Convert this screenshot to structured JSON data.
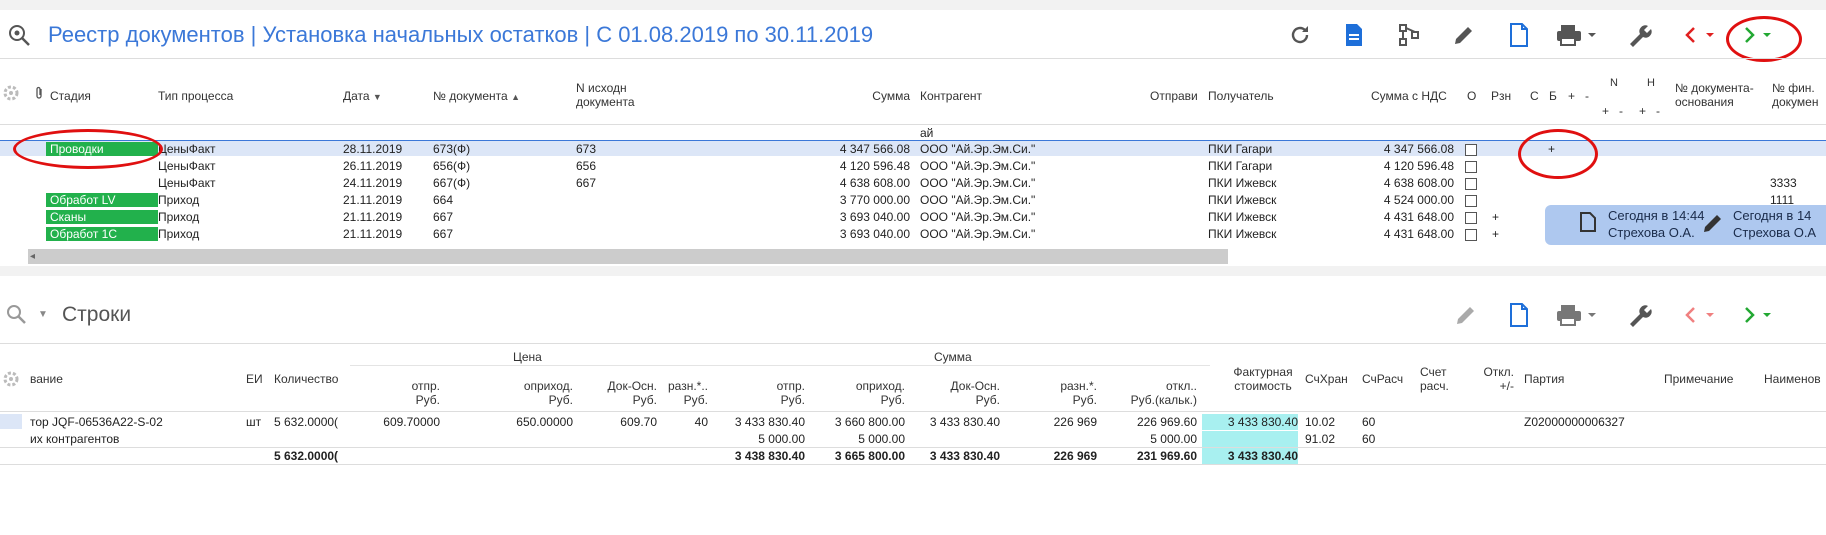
{
  "header": {
    "title": "Реестр документов | Установка начальных остатков | С 01.08.2019 по 30.11.2019"
  },
  "colors": {
    "accent": "#3b78d8",
    "badge": "#22b14c",
    "teal": "#a8f0f0",
    "highlight": "#e01010",
    "selected_row": "#dce6f7"
  },
  "icons": [
    "search-settings-icon",
    "refresh-icon",
    "document-icon",
    "process-icon",
    "edit-icon",
    "new-document-icon",
    "print-icon",
    "tools-icon",
    "prev-icon",
    "next-icon",
    "gear-icon",
    "attachment-icon"
  ],
  "top_table": {
    "headers": {
      "stage": "Стадия",
      "process_type": "Тип процесса",
      "date": "Дата",
      "doc_num": "№ документа",
      "orig_doc_1": "N исходн",
      "orig_doc_2": "документа",
      "sum": "Сумма",
      "contractor": "Контрагент",
      "sender": "Отправи",
      "receiver": "Получатель",
      "sum_vat": "Сумма с НДС",
      "o": "О",
      "rzn": "Рзн",
      "c": "С",
      "b": "Б",
      "plus": "+",
      "minus": "-",
      "n": "N",
      "h": "Н",
      "nplus": "+",
      "nminus": "-",
      "hplus": "+",
      "hminus": "-",
      "base_doc_1": "№ документа-",
      "base_doc_2": "основания",
      "fin_doc_1": "№ фин.",
      "fin_doc_2": "докумен"
    },
    "filter_text": "ай",
    "rows": [
      {
        "stage": "Проводки",
        "type": "ЦеныФакт",
        "date": "28.11.2019",
        "num": "673(Ф)",
        "orig": "673",
        "sum": "4 347 566.08",
        "contr": "ООО \"Ай.Эр.Эм.Си.\"",
        "recv": "ПКИ Гагари",
        "sumvat": "4 347 566.08",
        "plus": "",
        "fin": "+",
        "extra": ""
      },
      {
        "stage": "",
        "type": "ЦеныФакт",
        "date": "26.11.2019",
        "num": "656(Ф)",
        "orig": "656",
        "sum": "4 120 596.48",
        "contr": "ООО \"Ай.Эр.Эм.Си.\"",
        "recv": "ПКИ Гагари",
        "sumvat": "4 120 596.48",
        "plus": "",
        "fin": "",
        "extra": ""
      },
      {
        "stage": "",
        "type": "ЦеныФакт",
        "date": "24.11.2019",
        "num": "667(Ф)",
        "orig": "667",
        "sum": "4 638 608.00",
        "contr": "ООО \"Ай.Эр.Эм.Си.\"",
        "recv": "ПКИ Ижевск",
        "sumvat": "4 638 608.00",
        "plus": "",
        "fin": "",
        "extra": "3333"
      },
      {
        "stage": "Обработ LV",
        "type": "Приход",
        "date": "21.11.2019",
        "num": "664",
        "orig": "",
        "sum": "3 770 000.00",
        "contr": "ООО \"Ай.Эр.Эм.Си.\"",
        "recv": "ПКИ Ижевск",
        "sumvat": "4 524 000.00",
        "plus": "",
        "fin": "",
        "extra": "1111"
      },
      {
        "stage": "Сканы",
        "type": "Приход",
        "date": "21.11.2019",
        "num": "667",
        "orig": "",
        "sum": "3 693 040.00",
        "contr": "ООО \"Ай.Эр.Эм.Си.\"",
        "recv": "ПКИ Ижевск",
        "sumvat": "4 431 648.00",
        "plus": "+",
        "fin": "",
        "extra": ""
      },
      {
        "stage": "Обработ 1С",
        "type": "Приход",
        "date": "21.11.2019",
        "num": "667",
        "orig": "",
        "sum": "3 693 040.00",
        "contr": "ООО \"Ай.Эр.Эм.Си.\"",
        "recv": "ПКИ Ижевск",
        "sumvat": "4 431 648.00",
        "plus": "+",
        "fin": "",
        "extra": ""
      }
    ]
  },
  "notification": {
    "item1_line1": "Сегодня в 14:44",
    "item1_line2": "Стрехова О.А.",
    "item2_line1": "Сегодня в 14",
    "item2_line2": "Стрехова О.А"
  },
  "lines_panel": {
    "title": "Строки",
    "headers": {
      "name": "вание",
      "unit": "ЕИ",
      "qty": "Количество",
      "price_group": "Цена",
      "sum_group": "Сумма",
      "p_otpr_1": "отпр.",
      "p_otpr_2": "Руб.",
      "p_oprih_1": "оприход.",
      "p_oprih_2": "Руб.",
      "p_dok_1": "Док-Осн.",
      "p_dok_2": "Руб.",
      "p_razn_1": "разн.*..",
      "p_razn_2": "Руб.",
      "s_otpr_1": "отпр.",
      "s_otpr_2": "Руб.",
      "s_oprih_1": "оприход.",
      "s_oprih_2": "Руб.",
      "s_dok_1": "Док-Осн.",
      "s_dok_2": "Руб.",
      "s_razn_1": "разн.*.",
      "s_razn_2": "Руб.",
      "s_otkl_1": "откл..",
      "s_otkl_2": "Руб.(кальк.)",
      "fact_1": "Фактурная",
      "fact_2": "стоимость",
      "sch_hran": "СчХран",
      "sch_rasch": "СчРасч",
      "schet_1": "Счет",
      "schet_2": "расч.",
      "otkl_1": "Откл.",
      "otkl_2": "+/-",
      "partiya": "Партия",
      "prim": "Примечание",
      "naim": "Наименов"
    },
    "rows": [
      {
        "name": "тор JQF-06536A22-S-02",
        "unit": "шт",
        "qty": "5 632.0000(",
        "p_otpr": "609.70000",
        "p_oprih": "650.00000",
        "p_dok": "609.70",
        "p_razn": "40",
        "s_otpr": "3 433 830.40",
        "s_oprih": "3 660 800.00",
        "s_dok": "3 433 830.40",
        "s_razn": "226 969",
        "s_otkl": "226 969.60",
        "fact": "3 433 830.40",
        "hran": "10.02",
        "rasch": "60",
        "part": "Z02000000006327"
      },
      {
        "name": "их контрагентов",
        "unit": "",
        "qty": "",
        "p_otpr": "",
        "p_oprih": "",
        "p_dok": "",
        "p_razn": "",
        "s_otpr": "5 000.00",
        "s_oprih": "5 000.00",
        "s_dok": "",
        "s_razn": "",
        "s_otkl": "5 000.00",
        "fact": "",
        "hran": "91.02",
        "rasch": "60",
        "part": ""
      }
    ],
    "totals": {
      "qty": "5 632.0000(",
      "s_otpr": "3 438 830.40",
      "s_oprih": "3 665 800.00",
      "s_dok": "3 433 830.40",
      "s_razn": "226 969",
      "s_otkl": "231 969.60",
      "fact": "3 433 830.40"
    }
  }
}
